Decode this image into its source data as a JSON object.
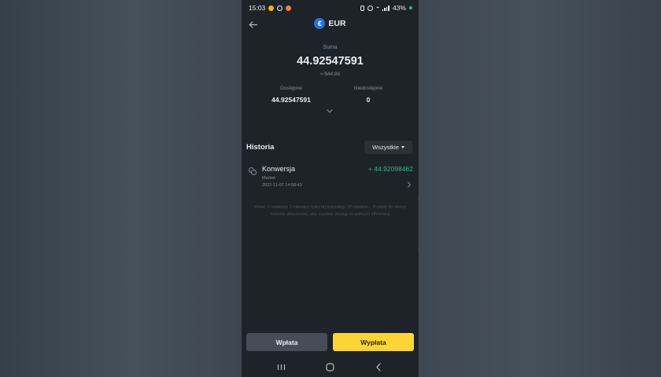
{
  "status_bar": {
    "time": "15:03",
    "battery": "43%"
  },
  "header": {
    "title": "EUR",
    "currency_glyph": "€",
    "back_icon": "arrow-left-icon"
  },
  "balance": {
    "total_label": "Suma",
    "total_value": "44.92547591",
    "approx_value": "≈ $44.86",
    "available_label": "Dostępne",
    "available_value": "44.92547591",
    "unavailable_label": "Niedostępne",
    "unavailable_value": "0",
    "expand_icon": "chevron-down-icon"
  },
  "history": {
    "title": "Historia",
    "filter_label": "Wszystkie",
    "transactions": [
      {
        "type": "Konwersja",
        "subtype": "Market",
        "date": "2022-11-07 14:58:43",
        "amount": "+ 44.92098462",
        "icon": "convert-icon"
      }
    ],
    "notice": "Widać 2 ostatnich 3 miesiący tylko tej transakcji. W ostatnie... Przejdź do strony Historia aktywności, aby uzyskać dostęp do pełnych informacji"
  },
  "actions": {
    "deposit_label": "Wpłata",
    "withdraw_label": "Wypłata"
  },
  "nav": {
    "recents_icon": "recents-icon",
    "home_icon": "home-icon",
    "back_icon": "back-icon"
  },
  "colors": {
    "background": "#1e2329",
    "positive": "#2ebd85",
    "accent": "#fcd535",
    "muted": "#848e9c"
  }
}
